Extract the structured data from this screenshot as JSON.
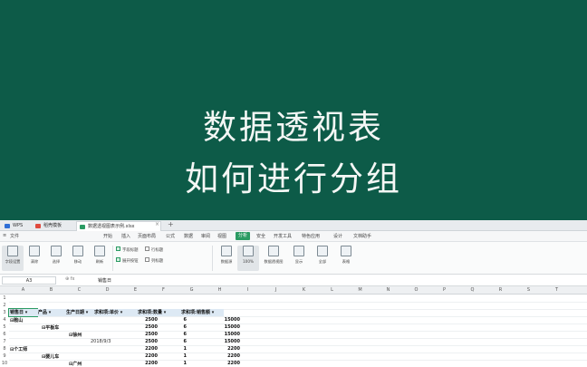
{
  "banner": {
    "line1": "数据透视表",
    "line2": "如何进行分组",
    "bg": "#0d5b48"
  },
  "tabs": [
    {
      "label": "WPS",
      "icon": "wps-logo-icon"
    },
    {
      "label": "稻壳模板",
      "icon": "template-icon"
    },
    {
      "label": "数据透视图表示例.xlsx",
      "icon": "sheet-file-icon",
      "active": true
    }
  ],
  "menu": [
    "文件",
    "开始",
    "插入",
    "页面布局",
    "公式",
    "数据",
    "审阅",
    "视图",
    "分析",
    "安全",
    "开发工具",
    "特色应用",
    "文档助手",
    "设计"
  ],
  "menu_active": "分析",
  "ribbon": {
    "buttons": [
      "字段设置",
      "清除",
      "选择",
      "移动",
      "刷新",
      "数据源",
      "数据透视图",
      "显示",
      "全部",
      "表格"
    ],
    "checks": [
      "字段标题",
      "展开按钮",
      "行标题",
      "列标题"
    ],
    "zoom_label": "100%"
  },
  "formula": {
    "namebox": "A3",
    "value": "销售日"
  },
  "columns": [
    "A",
    "B",
    "C",
    "D",
    "E",
    "F",
    "G",
    "H",
    "I",
    "J",
    "K",
    "L",
    "M",
    "N",
    "O",
    "P",
    "Q",
    "R",
    "S",
    "T"
  ],
  "rows": [
    "1",
    "2",
    "3",
    "4",
    "5",
    "6",
    "7",
    "8",
    "9",
    "10",
    "11"
  ],
  "pivot": {
    "headers": [
      "销售日",
      "产品",
      "生产日期",
      "求和项:单价",
      "求和项:数量",
      "求和项:销售额"
    ],
    "data": [
      {
        "a": "⊟鞍山",
        "b": "",
        "d": "",
        "e": "2500",
        "f": "6",
        "g": "15000"
      },
      {
        "a": "",
        "b": "⊟平板车",
        "d": "",
        "e": "2500",
        "f": "6",
        "g": "15000"
      },
      {
        "a": "",
        "b": "",
        "c": "⊟徐州",
        "d": "",
        "e": "2500",
        "f": "6",
        "g": "15000"
      },
      {
        "a": "",
        "b": "",
        "d": "2018/9/3",
        "e": "2500",
        "f": "6",
        "g": "15000"
      },
      {
        "a": "⊟个工师",
        "b": "",
        "d": "",
        "e": "2200",
        "f": "1",
        "g": "2200"
      },
      {
        "a": "",
        "b": "⊟婴儿车",
        "d": "",
        "e": "2200",
        "f": "1",
        "g": "2200"
      },
      {
        "a": "",
        "b": "",
        "c": "⊟广州",
        "d": "",
        "e": "2200",
        "f": "1",
        "g": "2200"
      }
    ]
  }
}
